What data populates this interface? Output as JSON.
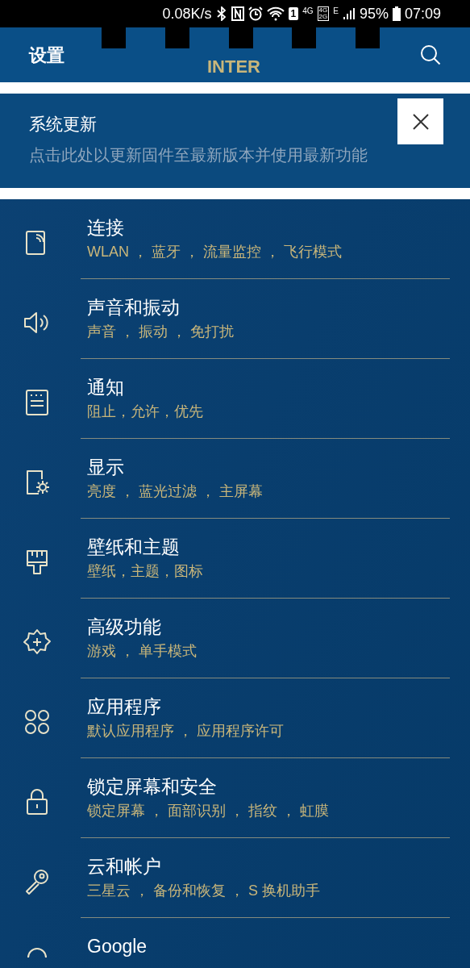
{
  "status_bar": {
    "speed": "0.08K/s",
    "sim_slot": "1",
    "network_4g": "4G",
    "dual_network_top": "4G",
    "dual_network_bottom": "2G",
    "network_e": "E",
    "battery": "95%",
    "time": "07:09"
  },
  "header": {
    "title": "设置",
    "logo_text": "INTER"
  },
  "update_banner": {
    "title": "系统更新",
    "description": "点击此处以更新固件至最新版本并使用最新功能"
  },
  "items": [
    {
      "title": "连接",
      "subtitle": "WLAN ， 蓝牙 ， 流量监控 ， 飞行模式"
    },
    {
      "title": "声音和振动",
      "subtitle": "声音 ， 振动 ， 免打扰"
    },
    {
      "title": "通知",
      "subtitle": "阻止，允许，优先"
    },
    {
      "title": "显示",
      "subtitle": "亮度 ， 蓝光过滤 ， 主屏幕"
    },
    {
      "title": "壁纸和主题",
      "subtitle": "壁纸，主题，图标"
    },
    {
      "title": "高级功能",
      "subtitle": "游戏 ， 单手模式"
    },
    {
      "title": "应用程序",
      "subtitle": "默认应用程序 ， 应用程序许可"
    },
    {
      "title": "锁定屏幕和安全",
      "subtitle": "锁定屏幕 ， 面部识别 ， 指纹 ， 虹膜"
    },
    {
      "title": "云和帐户",
      "subtitle": "三星云 ， 备份和恢复 ， S 换机助手"
    },
    {
      "title": "Google"
    }
  ]
}
